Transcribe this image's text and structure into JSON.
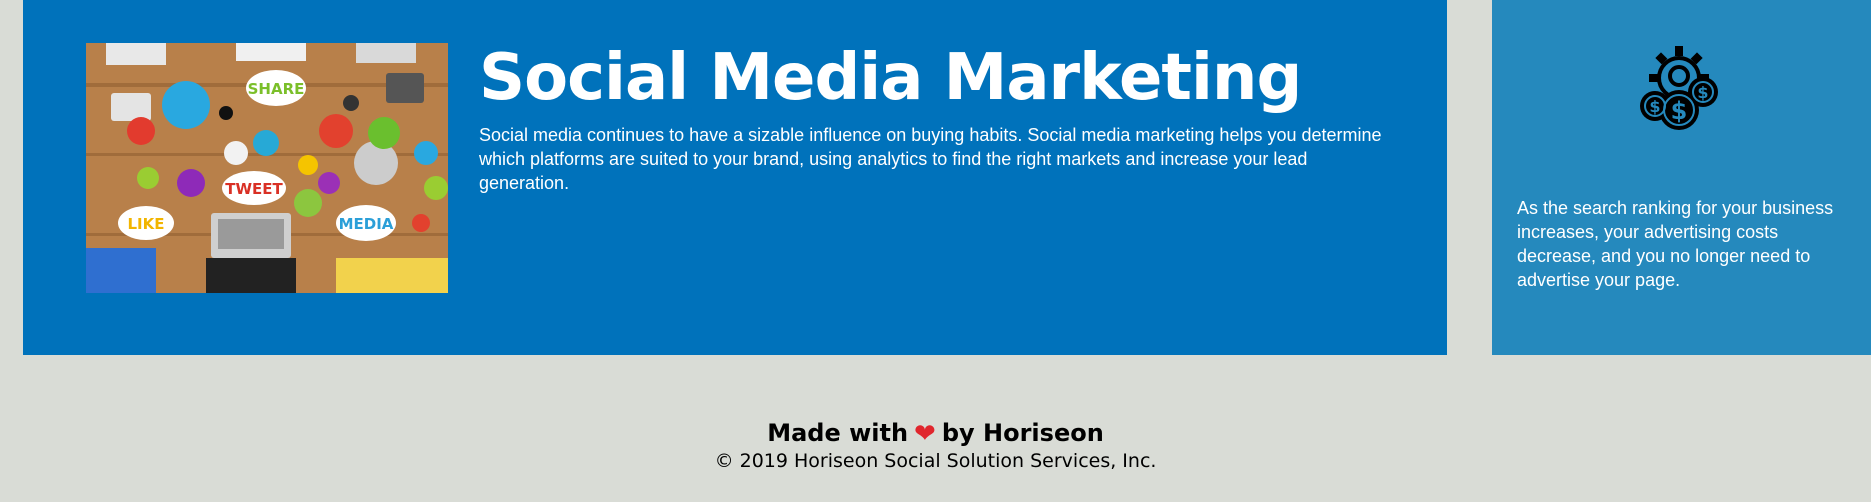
{
  "service": {
    "title": "Social Media Marketing",
    "description": "Social media continues to have a sizable influence on buying habits. Social media marketing helps you determine which platforms are suited to your brand, using analytics to find the right markets and increase your lead generation.",
    "image_icon": "social-media-marketing-photo",
    "image_words": [
      "SHARE",
      "TWEET",
      "LIKE",
      "MEDIA"
    ],
    "colors": {
      "background": "#0072bb",
      "text": "#ffffff"
    }
  },
  "benefit": {
    "icon": "cost-gears-dollar-icon",
    "text": "As the search ranking for your business increases, your advertising costs decrease, and you no longer need to advertise your page.",
    "colors": {
      "background": "#2589bd",
      "text": "#ffffff"
    }
  },
  "footer": {
    "made_with": "Made with",
    "heart_glyph": "❤",
    "by": "by Horiseon",
    "copyright": "© 2019 Horiseon Social Solution Services, Inc.",
    "colors": {
      "background": "#d9dcd6",
      "heart": "#e0262d"
    }
  }
}
